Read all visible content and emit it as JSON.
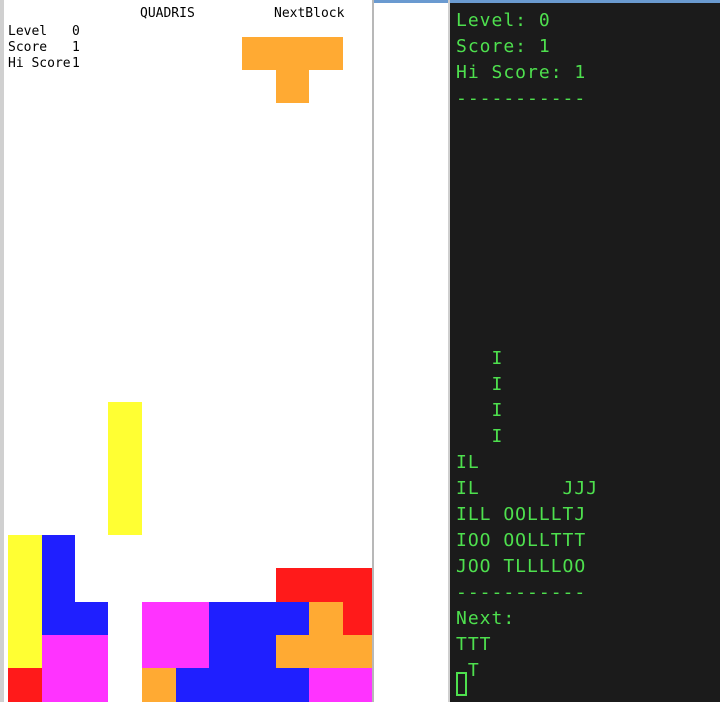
{
  "gui": {
    "title": "QUADRIS",
    "next_label": "NextBlock",
    "level_label": "Level",
    "level_value": "0",
    "score_label": "Score",
    "score_value": "1",
    "hiscore_label": "Hi Score",
    "hiscore_value": "1"
  },
  "colors": {
    "I": "#ffff33",
    "J": "#1f1fff",
    "L": "#ff33ff",
    "O": "#ffaa33",
    "T": "#ffaa33",
    "S": "#ff1a1a",
    "Z": "#ff1a1a",
    "red": "#ff1a1a",
    "terminal_text": "#4ee04e",
    "terminal_bg": "#1b1b1b"
  },
  "terminal": {
    "lines": [
      "Level: 0",
      "Score: 1",
      "Hi Score: 1",
      "-----------",
      "",
      "",
      "",
      "",
      "",
      "",
      "",
      "",
      "",
      "   I",
      "   I",
      "   I",
      "   I",
      "IL",
      "IL       JJJ",
      "ILL OOLLLTJ",
      "IOO OOLLTTT",
      "JOO TLLLLOO",
      "-----------",
      "Next:",
      "TTT",
      " T"
    ]
  }
}
